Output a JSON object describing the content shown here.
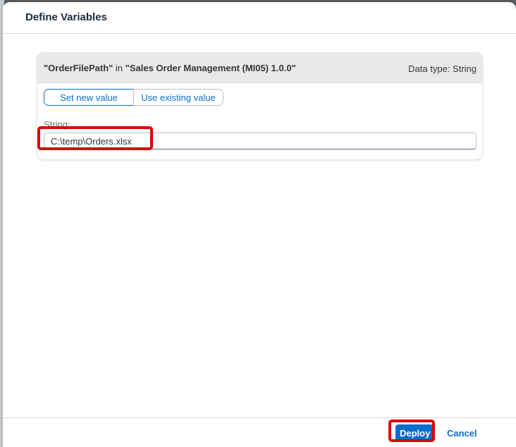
{
  "dialog": {
    "title": "Define Variables"
  },
  "variable": {
    "name_quoted": "\"OrderFilePath\"",
    "in_word": "in",
    "package_quoted": "\"Sales Order Management (MI05) 1.0.0\"",
    "data_type": "Data type: String",
    "set_new_label": "Set new value",
    "use_existing_label": "Use existing value",
    "field_label": "String:",
    "value": "C:\\temp\\Orders.xlsx"
  },
  "footer": {
    "deploy_label": "Deploy",
    "cancel_label": "Cancel"
  },
  "colors": {
    "accent": "#0a6ed1",
    "highlight": "#e00000"
  }
}
